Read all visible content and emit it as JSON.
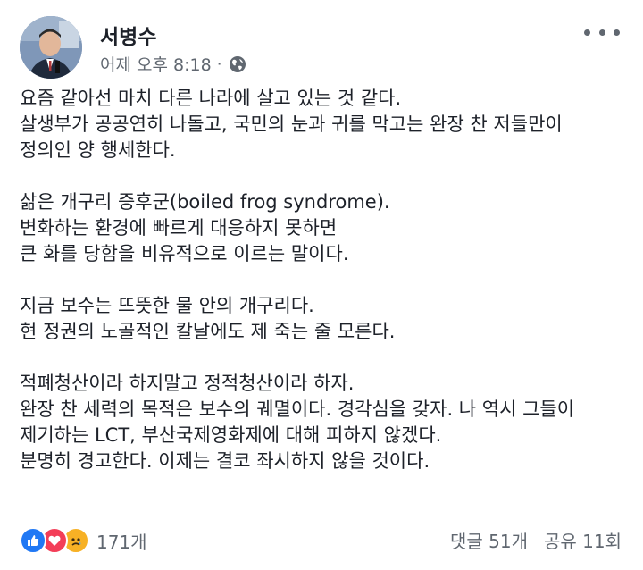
{
  "post": {
    "author": "서병수",
    "timestamp": "어제 오후 8:18",
    "separator": "·",
    "visibility_icon": "globe-icon",
    "more_icon": "more-horizontal-icon",
    "paragraphs": [
      [
        "요즘 같아선 마치 다른 나라에 살고 있는 것 같다.",
        "살생부가 공공연히 나돌고, 국민의 눈과 귀를 막고는 완장 찬 저들만이",
        "정의인 양 행세한다."
      ],
      [
        "삶은 개구리 증후군(boiled frog syndrome).",
        "변화하는 환경에 빠르게 대응하지 못하면",
        "큰 화를 당함을 비유적으로 이르는 말이다."
      ],
      [
        "지금 보수는 뜨뜻한 물 안의 개구리다.",
        "현 정권의 노골적인 칼날에도 제 죽는 줄 모른다."
      ],
      [
        "적폐청산이라 하지말고 정적청산이라 하자.",
        "완장 찬 세력의 목적은 보수의 궤멸이다. 경각심을 갖자. 나 역시 그들이",
        "제기하는 LCT, 부산국제영화제에 대해 피하지 않겠다.",
        "분명히 경고한다. 이제는 결코 좌시하지 않을 것이다."
      ]
    ]
  },
  "footer": {
    "reactions": [
      "like-icon",
      "love-icon",
      "sad-icon"
    ],
    "reaction_count": "171개",
    "comments": "댓글 51개",
    "shares": "공유 11회"
  },
  "colors": {
    "text": "#1d2129",
    "secondary": "#606770",
    "like": "#2078f4",
    "love": "#f33e58",
    "sad": "#f7b125"
  }
}
